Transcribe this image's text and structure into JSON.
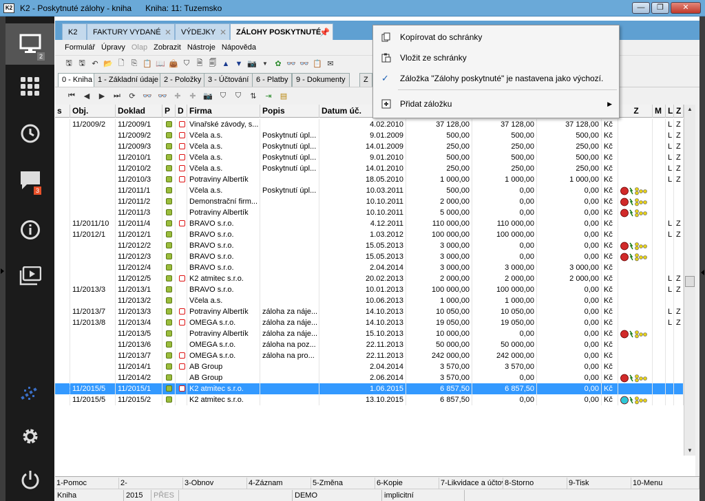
{
  "window": {
    "icon_label": "K2",
    "title": "K2 - Poskytnuté zálohy - kniha",
    "subtitle": "Kniha: 11: Tuzemsko",
    "minimize": "—",
    "maximize": "❐",
    "close": "✕"
  },
  "sidebar": {
    "items": [
      {
        "icon": "monitor-icon",
        "badge": "2"
      },
      {
        "icon": "grid-icon"
      },
      {
        "icon": "history-icon"
      },
      {
        "icon": "chat-icon",
        "badge": "3"
      },
      {
        "icon": "info-icon"
      },
      {
        "icon": "media-icon"
      },
      {
        "icon": "logo-icon"
      },
      {
        "icon": "gear-icon"
      },
      {
        "icon": "power-icon"
      }
    ]
  },
  "tabs": [
    {
      "label": "K2"
    },
    {
      "label": "FAKTURY VYDANÉ"
    },
    {
      "label": "VÝDEJKY"
    },
    {
      "label": "ZÁLOHY POSKYTNUTÉ"
    }
  ],
  "menu": {
    "items": [
      "Formulář",
      "Úpravy",
      "Olap",
      "Zobrazit",
      "Nástroje",
      "Nápověda"
    ],
    "disabled": "Olap"
  },
  "subtabs": [
    {
      "label": "0 - Kniha"
    },
    {
      "label": "1 - Základní údaje"
    },
    {
      "label": "2 - Položky"
    },
    {
      "label": "3 - Účtování"
    },
    {
      "label": "6 - Platby"
    },
    {
      "label": "9 - Dokumenty"
    },
    {
      "label": "Z"
    }
  ],
  "grid": {
    "headers": [
      "s",
      "Obj.",
      "Doklad",
      "P",
      "D",
      "Firma",
      "Popis",
      "Datum úč.",
      "",
      "",
      "",
      "",
      "Z",
      "M",
      "L",
      "Z"
    ],
    "rows": [
      {
        "obj": "11/2009/2",
        "doklad": "11/2009/1",
        "d": true,
        "firma": "Vinařské závody, s...",
        "popis": "",
        "datum": "4.02.2010",
        "a": "37 128,00",
        "b": "37 128,00",
        "c": "37 128,00",
        "mena": "Kč",
        "z": "",
        "l": "L",
        "z2": "Z"
      },
      {
        "obj": "",
        "doklad": "11/2009/2",
        "d": true,
        "firma": "Včela a.s.",
        "popis": "Poskytnutí úpl...",
        "datum": "9.01.2009",
        "a": "500,00",
        "b": "500,00",
        "c": "500,00",
        "mena": "Kč",
        "z": "",
        "l": "L",
        "z2": "Z"
      },
      {
        "obj": "",
        "doklad": "11/2009/3",
        "d": true,
        "firma": "Včela a.s.",
        "popis": "Poskytnutí úpl...",
        "datum": "14.01.2009",
        "a": "250,00",
        "b": "250,00",
        "c": "250,00",
        "mena": "Kč",
        "z": "",
        "l": "L",
        "z2": "Z"
      },
      {
        "obj": "",
        "doklad": "11/2010/1",
        "d": true,
        "firma": "Včela a.s.",
        "popis": "Poskytnutí úpl...",
        "datum": "9.01.2010",
        "a": "500,00",
        "b": "500,00",
        "c": "500,00",
        "mena": "Kč",
        "z": "",
        "l": "L",
        "z2": "Z"
      },
      {
        "obj": "",
        "doklad": "11/2010/2",
        "d": true,
        "firma": "Včela a.s.",
        "popis": "Poskytnutí úpl...",
        "datum": "14.01.2010",
        "a": "250,00",
        "b": "250,00",
        "c": "250,00",
        "mena": "Kč",
        "z": "",
        "l": "L",
        "z2": "Z"
      },
      {
        "obj": "",
        "doklad": "11/2010/3",
        "d": true,
        "firma": "Potraviny Albertík",
        "popis": "",
        "datum": "18.05.2010",
        "a": "1 000,00",
        "b": "1 000,00",
        "c": "1 000,00",
        "mena": "Kč",
        "z": "",
        "l": "L",
        "z2": "Z"
      },
      {
        "obj": "",
        "doklad": "11/2011/1",
        "d": false,
        "firma": "Včela a.s.",
        "popis": "Poskytnutí úpl...",
        "datum": "10.03.2011",
        "a": "500,00",
        "b": "0,00",
        "c": "0,00",
        "mena": "Kč",
        "z": "red",
        "l": "",
        "z2": ""
      },
      {
        "obj": "",
        "doklad": "11/2011/2",
        "d": false,
        "firma": "Demonstrační firm...",
        "popis": "",
        "datum": "10.10.2011",
        "a": "2 000,00",
        "b": "0,00",
        "c": "0,00",
        "mena": "Kč",
        "z": "red",
        "l": "",
        "z2": ""
      },
      {
        "obj": "",
        "doklad": "11/2011/3",
        "d": false,
        "firma": "Potraviny Albertík",
        "popis": "",
        "datum": "10.10.2011",
        "a": "5 000,00",
        "b": "0,00",
        "c": "0,00",
        "mena": "Kč",
        "z": "red",
        "l": "",
        "z2": ""
      },
      {
        "obj": "11/2011/10",
        "doklad": "11/2011/4",
        "d": true,
        "firma": "BRAVO s.r.o.",
        "popis": "",
        "datum": "4.12.2011",
        "a": "110 000,00",
        "b": "110 000,00",
        "c": "0,00",
        "mena": "Kč",
        "z": "",
        "l": "L",
        "z2": "Z"
      },
      {
        "obj": "11/2012/1",
        "doklad": "11/2012/1",
        "d": false,
        "firma": "BRAVO s.r.o.",
        "popis": "",
        "datum": "1.03.2012",
        "a": "100 000,00",
        "b": "100 000,00",
        "c": "0,00",
        "mena": "Kč",
        "z": "",
        "l": "L",
        "z2": "Z"
      },
      {
        "obj": "",
        "doklad": "11/2012/2",
        "d": false,
        "firma": "BRAVO s.r.o.",
        "popis": "",
        "datum": "15.05.2013",
        "a": "3 000,00",
        "b": "0,00",
        "c": "0,00",
        "mena": "Kč",
        "z": "red",
        "l": "",
        "z2": ""
      },
      {
        "obj": "",
        "doklad": "11/2012/3",
        "d": false,
        "firma": "BRAVO s.r.o.",
        "popis": "",
        "datum": "15.05.2013",
        "a": "3 000,00",
        "b": "0,00",
        "c": "0,00",
        "mena": "Kč",
        "z": "red",
        "l": "",
        "z2": ""
      },
      {
        "obj": "",
        "doklad": "11/2012/4",
        "d": false,
        "firma": "BRAVO s.r.o.",
        "popis": "",
        "datum": "2.04.2014",
        "a": "3 000,00",
        "b": "3 000,00",
        "c": "3 000,00",
        "mena": "Kč",
        "z": "",
        "l": "",
        "z2": ""
      },
      {
        "obj": "",
        "doklad": "11/2012/5",
        "d": true,
        "firma": "K2 atmitec s.r.o.",
        "popis": "",
        "datum": "20.02.2013",
        "a": "2 000,00",
        "b": "2 000,00",
        "c": "2 000,00",
        "mena": "Kč",
        "z": "",
        "l": "L",
        "z2": "Z"
      },
      {
        "obj": "11/2013/3",
        "doklad": "11/2013/1",
        "d": false,
        "firma": "BRAVO s.r.o.",
        "popis": "",
        "datum": "10.01.2013",
        "a": "100 000,00",
        "b": "100 000,00",
        "c": "0,00",
        "mena": "Kč",
        "z": "",
        "l": "L",
        "z2": "Z"
      },
      {
        "obj": "",
        "doklad": "11/2013/2",
        "d": false,
        "firma": "Včela a.s.",
        "popis": "",
        "datum": "10.06.2013",
        "a": "1 000,00",
        "b": "1 000,00",
        "c": "0,00",
        "mena": "Kč",
        "z": "",
        "l": "",
        "z2": ""
      },
      {
        "obj": "11/2013/7",
        "doklad": "11/2013/3",
        "d": true,
        "firma": "Potraviny Albertík",
        "popis": "záloha za náje...",
        "datum": "14.10.2013",
        "a": "10 050,00",
        "b": "10 050,00",
        "c": "0,00",
        "mena": "Kč",
        "z": "",
        "l": "L",
        "z2": "Z"
      },
      {
        "obj": "11/2013/8",
        "doklad": "11/2013/4",
        "d": true,
        "firma": "OMEGA s.r.o.",
        "popis": "záloha za náje...",
        "datum": "14.10.2013",
        "a": "19 050,00",
        "b": "19 050,00",
        "c": "0,00",
        "mena": "Kč",
        "z": "",
        "l": "L",
        "z2": "Z"
      },
      {
        "obj": "",
        "doklad": "11/2013/5",
        "d": false,
        "firma": "Potraviny Albertík",
        "popis": "záloha za náje...",
        "datum": "15.10.2013",
        "a": "10 000,00",
        "b": "0,00",
        "c": "0,00",
        "mena": "Kč",
        "z": "red",
        "l": "",
        "z2": ""
      },
      {
        "obj": "",
        "doklad": "11/2013/6",
        "d": false,
        "firma": "OMEGA s.r.o.",
        "popis": "záloha na poz...",
        "datum": "22.11.2013",
        "a": "50 000,00",
        "b": "50 000,00",
        "c": "0,00",
        "mena": "Kč",
        "z": "",
        "l": "",
        "z2": ""
      },
      {
        "obj": "",
        "doklad": "11/2013/7",
        "d": true,
        "firma": "OMEGA s.r.o.",
        "popis": "záloha na pro...",
        "datum": "22.11.2013",
        "a": "242 000,00",
        "b": "242 000,00",
        "c": "0,00",
        "mena": "Kč",
        "z": "",
        "l": "",
        "z2": ""
      },
      {
        "obj": "",
        "doklad": "11/2014/1",
        "d": true,
        "firma": "AB Group",
        "popis": "",
        "datum": "2.04.2014",
        "a": "3 570,00",
        "b": "3 570,00",
        "c": "0,00",
        "mena": "Kč",
        "z": "",
        "l": "",
        "z2": ""
      },
      {
        "obj": "",
        "doklad": "11/2014/2",
        "d": false,
        "firma": "AB Group",
        "popis": "",
        "datum": "2.06.2014",
        "a": "3 570,00",
        "b": "0,00",
        "c": "0,00",
        "mena": "Kč",
        "z": "red",
        "l": "",
        "z2": ""
      },
      {
        "obj": "11/2015/5",
        "doklad": "11/2015/1",
        "d": true,
        "firma": "K2 atmitec s.r.o.",
        "popis": "",
        "datum": "1.06.2015",
        "a": "6 857,50",
        "b": "6 857,50",
        "c": "0,00",
        "mena": "Kč",
        "z": "",
        "l": "",
        "z2": "",
        "selected": true
      },
      {
        "obj": "11/2015/5",
        "doklad": "11/2015/2",
        "d": false,
        "firma": "K2 atmitec s.r.o.",
        "popis": "",
        "datum": "13.10.2015",
        "a": "6 857,50",
        "b": "0,00",
        "c": "0,00",
        "mena": "Kč",
        "z": "cyan",
        "l": "",
        "z2": ""
      }
    ]
  },
  "context_menu": {
    "items": [
      {
        "label": "Kopírovat do schránky"
      },
      {
        "label": "Vložit ze schránky"
      },
      {
        "label": "Záložka \"Zálohy poskytnuté\" je nastavena jako výchozí."
      },
      {
        "label": "Přidat záložku"
      }
    ]
  },
  "fkeys": [
    "1-Pomoc",
    "2-",
    "3-Obnov",
    "4-Záznam",
    "5-Změna",
    "6-Kopie",
    "7-Likvidace a účtov",
    "8-Storno",
    "9-Tisk",
    "10-Menu"
  ],
  "status": [
    "Kniha",
    "2015",
    "PŘES",
    "DEMO",
    "implicitní"
  ],
  "colors": {
    "accent": "#5fa0d2",
    "selection": "#3399ff",
    "sidebar": "#1b1b1b"
  }
}
